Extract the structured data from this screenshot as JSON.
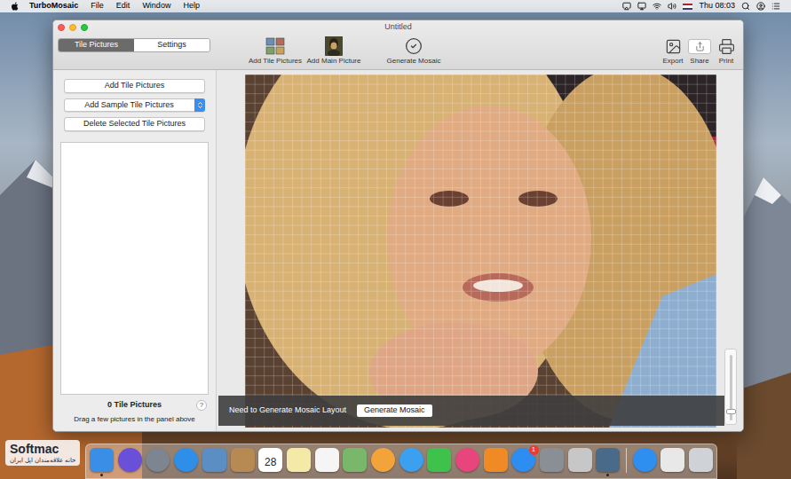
{
  "menubar": {
    "app": "TurboMosaic",
    "menus": [
      "File",
      "Edit",
      "Window",
      "Help"
    ],
    "clock": "Thu 08:03"
  },
  "window": {
    "title": "Untitled"
  },
  "tabs": [
    {
      "label": "Tile Pictures",
      "selected": true
    },
    {
      "label": "Settings",
      "selected": false
    }
  ],
  "toolbar": {
    "left": [
      {
        "label": "Add Tile Pictures"
      },
      {
        "label": "Add Main Picture"
      },
      {
        "label": "Generate Mosaic"
      }
    ],
    "right": [
      {
        "label": "Export"
      },
      {
        "label": "Share"
      },
      {
        "label": "Print"
      }
    ]
  },
  "sidebar": {
    "buttons": [
      {
        "label": "Add Tile Pictures",
        "kind": "button"
      },
      {
        "label": "Add Sample Tile Pictures",
        "kind": "dropdown"
      },
      {
        "label": "Delete Selected Tile Pictures",
        "kind": "button"
      }
    ],
    "count": "0 Tile Pictures",
    "help": "?",
    "hint": "Drag a few pictures in the panel above"
  },
  "notice": {
    "text": "Need to Generate Mosaic Layout",
    "button": "Generate Mosaic"
  },
  "zoom": {
    "level": 0.1
  },
  "dock": [
    {
      "kind": "square",
      "color": "#3a8ee6",
      "running": true
    },
    {
      "kind": "circle",
      "color": "#6a4fd8",
      "running": false
    },
    {
      "kind": "circle",
      "color": "#7d8590",
      "running": false
    },
    {
      "kind": "circle",
      "color": "#2f8fe8",
      "running": false
    },
    {
      "kind": "square",
      "color": "#5b8fc4",
      "running": false
    },
    {
      "kind": "square",
      "color": "#b68a52",
      "running": false
    },
    {
      "kind": "square",
      "color": "#ffffff",
      "running": false,
      "text": "28"
    },
    {
      "kind": "square",
      "color": "#f4e9a6",
      "running": false
    },
    {
      "kind": "square",
      "color": "#f5f5f5",
      "running": false
    },
    {
      "kind": "square",
      "color": "#79b86a",
      "running": false
    },
    {
      "kind": "circle",
      "color": "#f2a33a",
      "running": false
    },
    {
      "kind": "circle",
      "color": "#3ba0f0",
      "running": false
    },
    {
      "kind": "square",
      "color": "#3ec24b",
      "running": false
    },
    {
      "kind": "circle",
      "color": "#e8457c",
      "running": false
    },
    {
      "kind": "square",
      "color": "#f08a24",
      "running": false
    },
    {
      "kind": "circle",
      "color": "#2d8df0",
      "running": false,
      "badge": "1"
    },
    {
      "kind": "square",
      "color": "#8a8f96",
      "running": false
    },
    {
      "kind": "square",
      "color": "#c7c7c7",
      "running": false
    },
    {
      "kind": "square",
      "color": "#4a6a8a",
      "running": true
    },
    {
      "kind": "circle",
      "color": "#2f8ff0",
      "running": false
    },
    {
      "kind": "square",
      "color": "#e8e8e8",
      "running": false
    },
    {
      "kind": "square",
      "color": "#cfd3d8",
      "running": false
    }
  ],
  "watermark": {
    "brand": "Softmac",
    "tagline": "خانه علاقه‌مندان اپل ایران"
  }
}
